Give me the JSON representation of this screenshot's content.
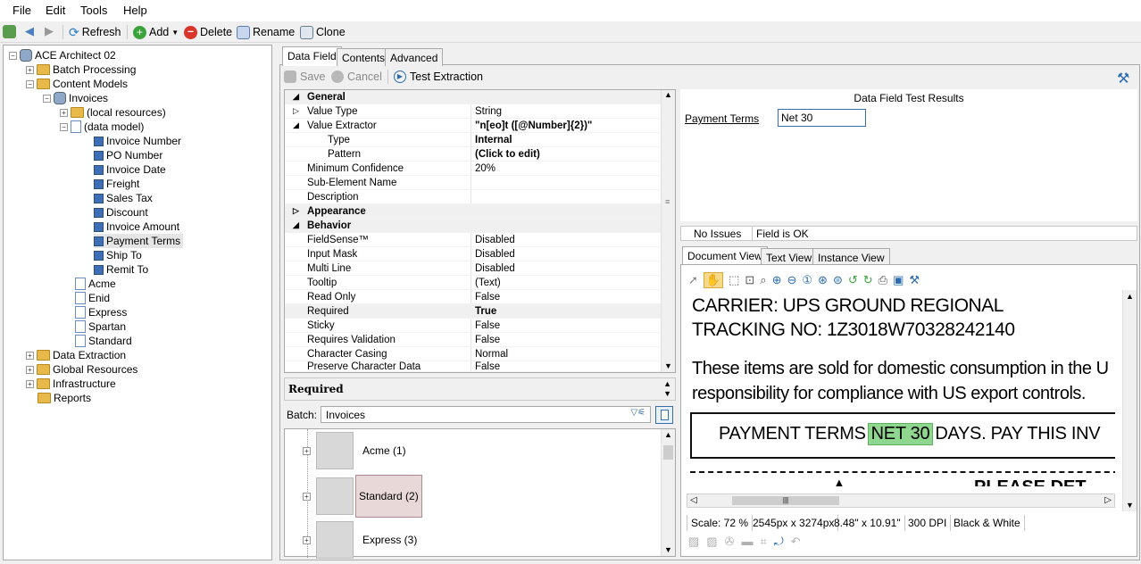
{
  "menu": {
    "file": "File",
    "edit": "Edit",
    "tools": "Tools",
    "help": "Help"
  },
  "toolbar": {
    "refresh": "Refresh",
    "add": "Add",
    "delete": "Delete",
    "rename": "Rename",
    "clone": "Clone"
  },
  "tree": {
    "root": "ACE Architect 02",
    "batch_processing": "Batch Processing",
    "content_models": "Content Models",
    "invoices": "Invoices",
    "local_resources": "(local resources)",
    "data_model": "(data model)",
    "fields": [
      "Invoice Number",
      "PO Number",
      "Invoice Date",
      "Freight",
      "Sales Tax",
      "Discount",
      "Invoice Amount",
      "Payment Terms",
      "Ship To",
      "Remit To"
    ],
    "classes": [
      "Acme",
      "Enid",
      "Express",
      "Spartan",
      "Standard"
    ],
    "data_extraction": "Data Extraction",
    "global_resources": "Global Resources",
    "infrastructure": "Infrastructure",
    "reports": "Reports"
  },
  "tabs": {
    "data_field": "Data Field",
    "contents": "Contents",
    "advanced": "Advanced"
  },
  "actions": {
    "save": "Save",
    "cancel": "Cancel",
    "test_extraction": "Test Extraction"
  },
  "props": {
    "general": "General",
    "value_type": {
      "name": "Value Type",
      "value": "String"
    },
    "value_extractor": {
      "name": "Value Extractor",
      "value": "\"n[eo]t ([@Number]{2})\""
    },
    "type": {
      "name": "Type",
      "value": "Internal"
    },
    "pattern": {
      "name": "Pattern",
      "value": "(Click to edit)"
    },
    "min_conf": {
      "name": "Minimum Confidence",
      "value": "20%"
    },
    "sub_elem": {
      "name": "Sub-Element Name",
      "value": ""
    },
    "description": {
      "name": "Description",
      "value": ""
    },
    "appearance": "Appearance",
    "behavior": "Behavior",
    "fieldsense": {
      "name": "FieldSense™",
      "value": "Disabled"
    },
    "input_mask": {
      "name": "Input Mask",
      "value": "Disabled"
    },
    "multi_line": {
      "name": "Multi Line",
      "value": "Disabled"
    },
    "tooltip": {
      "name": "Tooltip",
      "value": "(Text)"
    },
    "read_only": {
      "name": "Read Only",
      "value": "False"
    },
    "required": {
      "name": "Required",
      "value": "True"
    },
    "sticky": {
      "name": "Sticky",
      "value": "False"
    },
    "requires_validation": {
      "name": "Requires Validation",
      "value": "False"
    },
    "char_casing": {
      "name": "Character Casing",
      "value": "Normal"
    },
    "preserve_char": {
      "name": "Preserve Character Data",
      "value": "False"
    }
  },
  "description_title": "Required",
  "batch": {
    "label": "Batch:",
    "value": "Invoices",
    "items": [
      "Acme (1)",
      "Standard (2)",
      "Express (3)"
    ]
  },
  "results": {
    "title": "Data Field Test Results",
    "field_label": "Payment Terms",
    "field_value": "Net 30"
  },
  "status": {
    "issues": "No Issues",
    "message": "Field is OK"
  },
  "view_tabs": {
    "document": "Document View",
    "text": "Text View",
    "instance": "Instance View"
  },
  "document": {
    "line1": "CARRIER: UPS GROUND REGIONAL",
    "line2": "TRACKING NO: 1Z3018W70328242140",
    "line3": "These items are sold for domestic consumption in the U",
    "line4": "responsibility for compliance with US export controls.",
    "terms_prefix": "PAYMENT TERMS",
    "terms_highlight": "NET  30",
    "terms_suffix": "DAYS. PAY THIS INV",
    "partial": "PLEASE DET"
  },
  "doc_status": {
    "scale": "Scale: 72 %",
    "pixels": "2545px x 3274px",
    "inches": "8.48\" x 10.91\"",
    "dpi": "300 DPI",
    "color": "Black & White"
  },
  "colors": {
    "highlight": "#8fd68f",
    "selection": "#e8d8d8",
    "field_icon": "#3e6fb5",
    "folder": "#e8b94a"
  }
}
